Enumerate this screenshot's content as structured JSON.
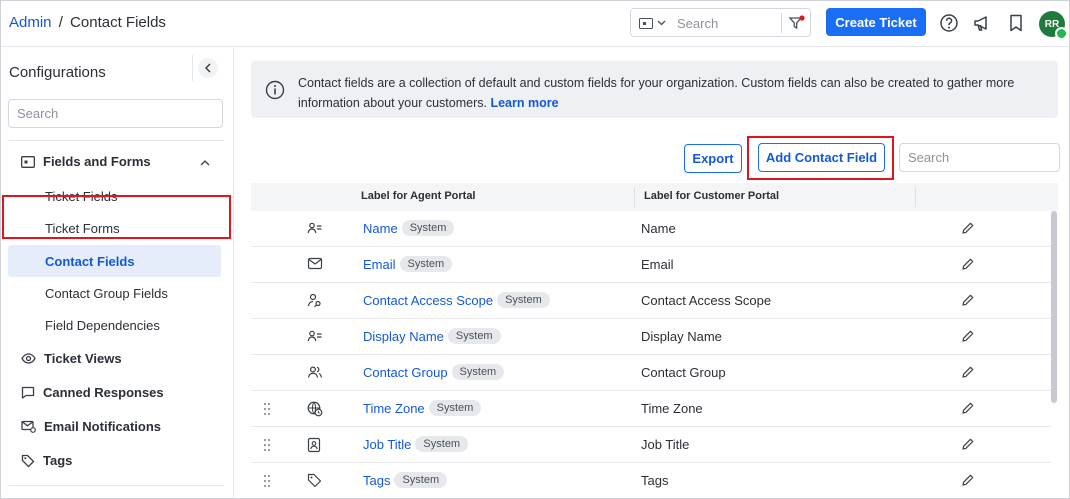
{
  "breadcrumb": {
    "root": "Admin",
    "separator": "/",
    "current": "Contact Fields"
  },
  "top_search": {
    "placeholder": "Search"
  },
  "create_ticket_label": "Create Ticket",
  "avatar_initials": "RR",
  "sidebar": {
    "title": "Configurations",
    "search_placeholder": "Search",
    "group_fields_forms": "Fields and Forms",
    "sub_items": [
      "Ticket Fields",
      "Ticket Forms",
      "Contact Fields",
      "Contact Group Fields",
      "Field Dependencies"
    ],
    "ticket_views": "Ticket Views",
    "canned_responses": "Canned Responses",
    "email_notifications": "Email Notifications",
    "tags": "Tags"
  },
  "info": {
    "text": "Contact fields are a collection of default and custom fields for your organization. Custom fields can also be created to gather more information about your customers.",
    "learn_more": "Learn more"
  },
  "actions": {
    "export": "Export",
    "add_contact_field": "Add Contact Field",
    "search_placeholder": "Search"
  },
  "table": {
    "headers": {
      "agent": "Label for Agent Portal",
      "customer": "Label for Customer Portal"
    },
    "rows": [
      {
        "agent": "Name",
        "badge": "System",
        "customer": "Name",
        "icon": "contact-card-icon"
      },
      {
        "agent": "Email",
        "badge": "System",
        "customer": "Email",
        "icon": "mail-icon"
      },
      {
        "agent": "Contact Access Scope",
        "badge": "System",
        "customer": "Contact Access Scope",
        "icon": "user-key-icon"
      },
      {
        "agent": "Display Name",
        "badge": "System",
        "customer": "Display Name",
        "icon": "contact-card-icon"
      },
      {
        "agent": "Contact Group",
        "badge": "System",
        "customer": "Contact Group",
        "icon": "users-icon"
      },
      {
        "agent": "Time Zone",
        "badge": "System",
        "customer": "Time Zone",
        "icon": "globe-clock-icon"
      },
      {
        "agent": "Job Title",
        "badge": "System",
        "customer": "Job Title",
        "icon": "id-badge-icon"
      },
      {
        "agent": "Tags",
        "badge": "System",
        "customer": "Tags",
        "icon": "tag-icon"
      }
    ]
  },
  "colors": {
    "accent": "#1a6ef5",
    "link": "#1558d6",
    "highlight": "#e0161e",
    "avatar_bg": "#1f7a3d"
  }
}
